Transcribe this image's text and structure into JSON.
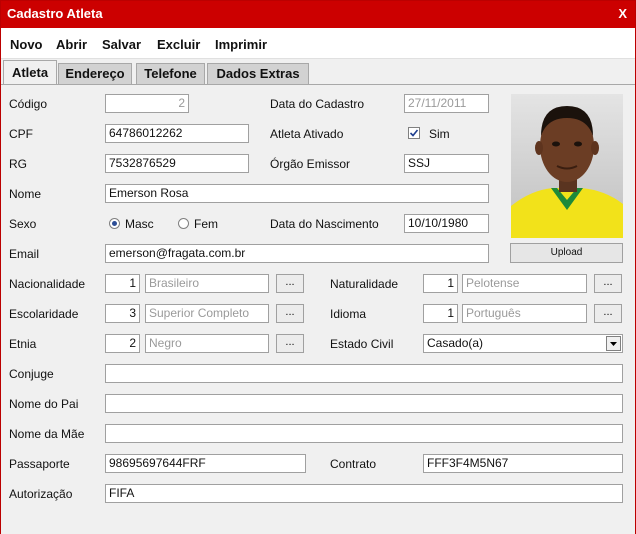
{
  "window": {
    "title": "Cadastro Atleta",
    "close_label": "X"
  },
  "menu": {
    "novo": "Novo",
    "abrir": "Abrir",
    "salvar": "Salvar",
    "excluir": "Excluir",
    "imprimir": "Imprimir"
  },
  "tabs": {
    "atleta": "Atleta",
    "endereco": "Endereço",
    "telefone": "Telefone",
    "dados_extras": "Dados Extras"
  },
  "form": {
    "codigo": {
      "label": "Código",
      "value": "2"
    },
    "data_cadastro": {
      "label": "Data do Cadastro",
      "value": "27/11/2011"
    },
    "cpf": {
      "label": "CPF",
      "value": "64786012262"
    },
    "atleta_ativado": {
      "label": "Atleta Ativado",
      "option": "Sim",
      "checked": true
    },
    "rg": {
      "label": "RG",
      "value": "7532876529"
    },
    "orgao_emissor": {
      "label": "Órgão Emissor",
      "value": "SSJ"
    },
    "nome": {
      "label": "Nome",
      "value": "Emerson Rosa"
    },
    "sexo": {
      "label": "Sexo",
      "masc": "Masc",
      "fem": "Fem",
      "selected": "Masc"
    },
    "data_nascimento": {
      "label": "Data do Nascimento",
      "value": "10/10/1980"
    },
    "email": {
      "label": "Email",
      "value": "emerson@fragata.com.br"
    },
    "upload_label": "Upload",
    "dots": "...",
    "nacionalidade": {
      "label": "Nacionalidade",
      "code": "1",
      "name": "Brasileiro"
    },
    "naturalidade": {
      "label": "Naturalidade",
      "code": "1",
      "name": "Pelotense"
    },
    "escolaridade": {
      "label": "Escolaridade",
      "code": "3",
      "name": "Superior Completo"
    },
    "idioma": {
      "label": "Idioma",
      "code": "1",
      "name": "Português"
    },
    "etnia": {
      "label": "Etnia",
      "code": "2",
      "name": "Negro"
    },
    "estado_civil": {
      "label": "Estado Civil",
      "value": "Casado(a)"
    },
    "conjuge": {
      "label": "Conjuge",
      "value": ""
    },
    "nome_pai": {
      "label": "Nome do Pai",
      "value": ""
    },
    "nome_mae": {
      "label": "Nome da Mãe",
      "value": ""
    },
    "passaporte": {
      "label": "Passaporte",
      "value": "98695697644FRF"
    },
    "contrato": {
      "label": "Contrato",
      "value": "FFF3F4M5N67"
    },
    "autorizacao": {
      "label": "Autorização",
      "value": "FIFA"
    }
  },
  "colors": {
    "titlebar": "#cc0000",
    "jersey": "#f2e21a",
    "jersey_trim": "#1e8a3a"
  }
}
